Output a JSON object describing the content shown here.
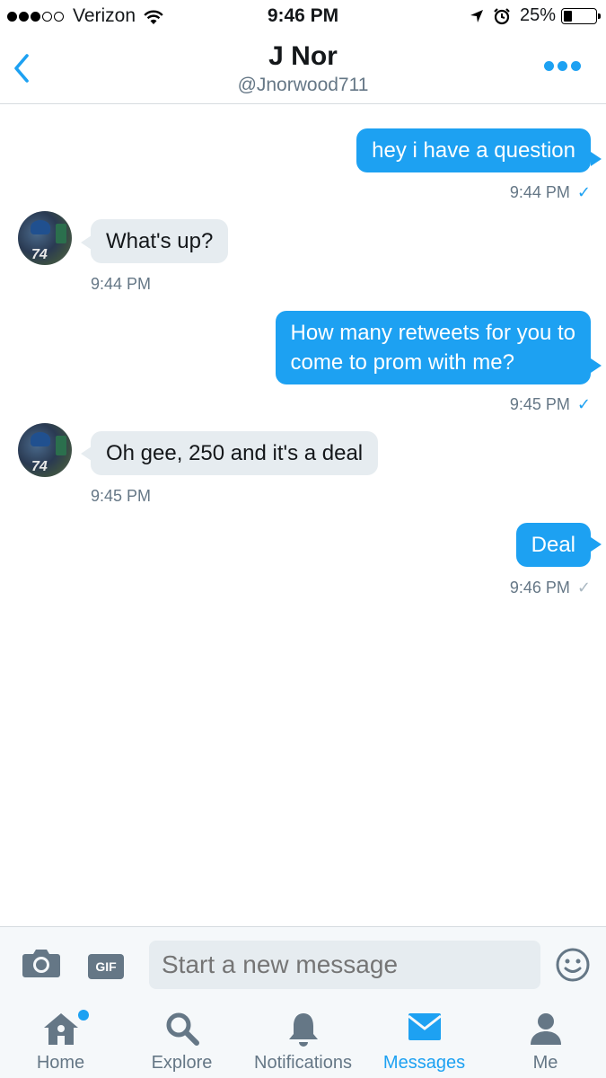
{
  "status_bar": {
    "carrier": "Verizon",
    "time": "9:46 PM",
    "battery": "25%",
    "battery_level": 0.25,
    "signal_bars_filled": 3,
    "signal_bars_total": 5
  },
  "header": {
    "title": "J Nor",
    "handle": "@Jnorwood711"
  },
  "messages": [
    {
      "direction": "out",
      "text": "hey i have a question",
      "time": "9:44 PM",
      "check": "✓",
      "check_color": "#1da1f2"
    },
    {
      "direction": "in",
      "text": "What's up?",
      "time": "9:44 PM",
      "avatar_text": "74"
    },
    {
      "direction": "out",
      "line1": "How many retweets for  you to",
      "line2": "come to prom with me?",
      "time": "9:45 PM",
      "check": "✓",
      "check_color": "#1da1f2"
    },
    {
      "direction": "in",
      "text": "Oh gee, 250 and it's a deal",
      "time": "9:45 PM",
      "avatar_text": "74"
    },
    {
      "direction": "out",
      "text": "Deal",
      "time": "9:46 PM",
      "check": "✓",
      "check_color": "#aab8c2"
    }
  ],
  "composer": {
    "gif_label": "GIF",
    "placeholder": "Start a new message",
    "camera_icon": "camera-icon",
    "emoji_icon": "emoji-icon"
  },
  "tabs": [
    {
      "label": "Home",
      "icon": "home-icon",
      "active": false,
      "has_dot": true
    },
    {
      "label": "Explore",
      "icon": "search-icon",
      "active": false
    },
    {
      "label": "Notifications",
      "icon": "bell-icon",
      "active": false
    },
    {
      "label": "Messages",
      "icon": "envelope-icon",
      "active": true
    },
    {
      "label": "Me",
      "icon": "person-icon",
      "active": false
    }
  ],
  "colors": {
    "accent": "#1da1f2",
    "incoming_bubble": "#e6ecf0",
    "secondary_text": "#657786"
  }
}
